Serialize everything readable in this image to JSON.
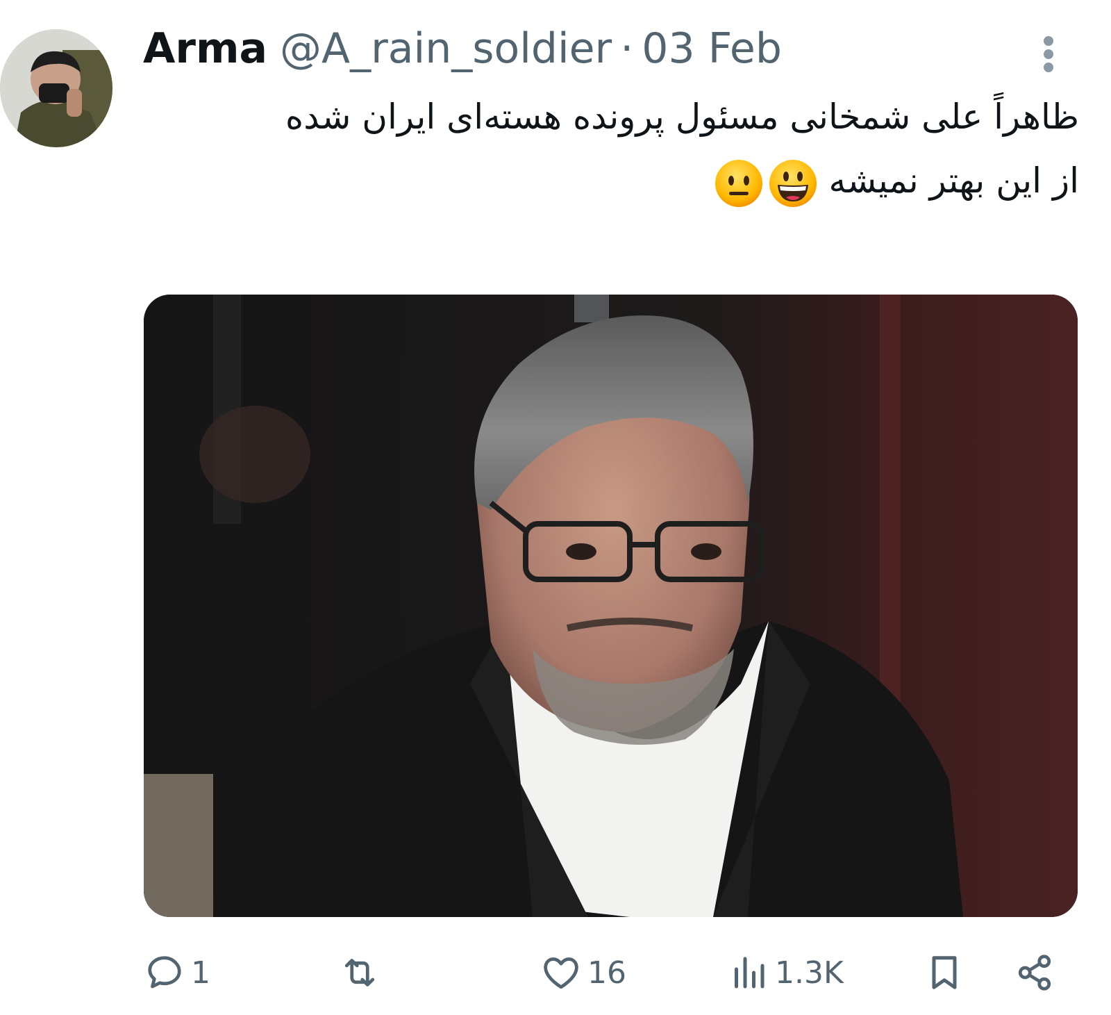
{
  "tweet": {
    "author": {
      "display_name": "Arma",
      "handle": "@A_rain_soldier",
      "separator": "·",
      "date": "03 Feb",
      "avatar_icon": "user-avatar"
    },
    "text_lines": [
      "ظاهراً علی شمخانی مسئول پرونده هسته‌ای ایران شده",
      "از این بهتر نمیشه"
    ],
    "emojis": [
      "grinning-face-emoji",
      "neutral-face-emoji"
    ],
    "media": {
      "icon": "photo-of-man-in-suit-and-glasses"
    },
    "actions": {
      "reply": {
        "icon": "reply-icon",
        "count": "1"
      },
      "retweet": {
        "icon": "retweet-icon",
        "count": ""
      },
      "like": {
        "icon": "heart-icon",
        "count": "16"
      },
      "views": {
        "icon": "views-icon",
        "count": "1.3K"
      },
      "bookmark": {
        "icon": "bookmark-icon"
      },
      "share": {
        "icon": "share-icon"
      }
    },
    "colors": {
      "text": "#0f1419",
      "secondary": "#536471",
      "background": "#ffffff"
    }
  }
}
